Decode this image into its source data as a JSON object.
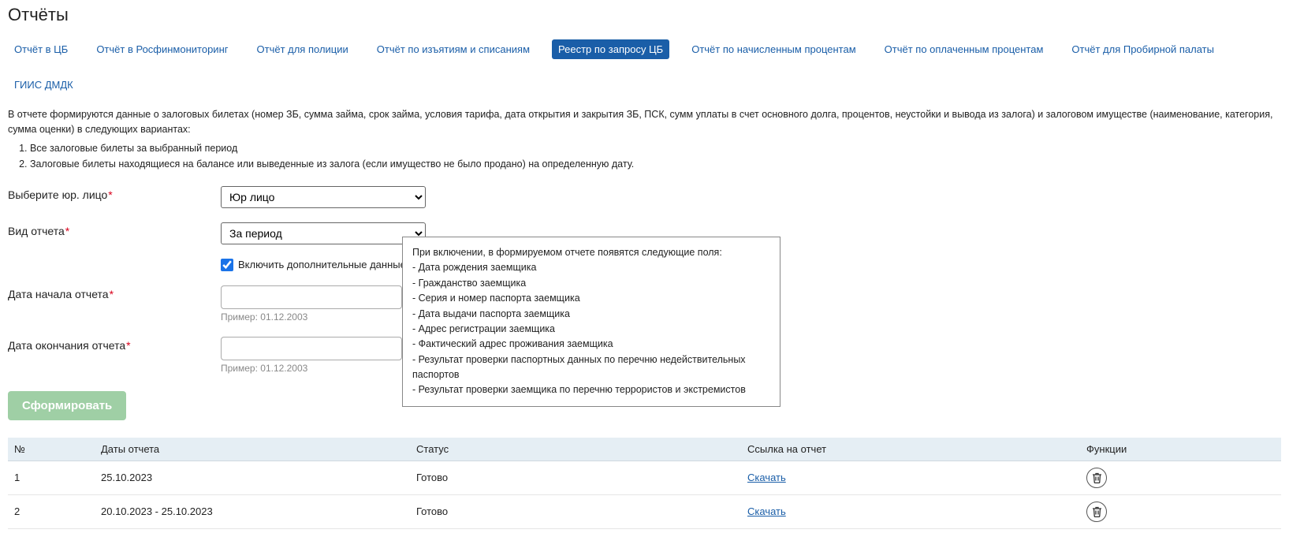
{
  "page_title": "Отчёты",
  "tabs": [
    {
      "label": "Отчёт в ЦБ",
      "active": false
    },
    {
      "label": "Отчёт в Росфинмониторинг",
      "active": false
    },
    {
      "label": "Отчёт для полиции",
      "active": false
    },
    {
      "label": "Отчёт по изъятиям и списаниям",
      "active": false
    },
    {
      "label": "Реестр по запросу ЦБ",
      "active": true
    },
    {
      "label": "Отчёт по начисленным процентам",
      "active": false
    },
    {
      "label": "Отчёт по оплаченным процентам",
      "active": false
    },
    {
      "label": "Отчёт для Пробирной палаты",
      "active": false
    },
    {
      "label": "ГИИС ДМДК",
      "active": false
    }
  ],
  "description": "В отчете формируются данные о залоговых билетах (номер ЗБ, сумма займа, срок займа, условия тарифа, дата открытия и закрытия ЗБ, ПСК, сумм уплаты в счет основного долга, процентов, неустойки и вывода из залога) и залоговом имуществе (наименование, категория, сумма оценки) в следующих вариантах:",
  "variants": [
    "Все залоговые билеты за выбранный период",
    "Залоговые билеты находящиеся на балансе или выведенные из залога (если имущество не было продано) на определенную дату."
  ],
  "form": {
    "entity_label": "Выберите юр. лицо",
    "entity_selected": "Юр лицо",
    "type_label": "Вид отчета",
    "type_selected": "За период",
    "include_extra_label": "Включить дополнительные данные",
    "include_extra_checked": true,
    "date_from_label": "Дата начала отчета",
    "date_from_value": "",
    "date_from_hint": "Пример: 01.12.2003",
    "date_to_label": "Дата окончания отчета",
    "date_to_value": "",
    "date_to_hint": "Пример: 01.12.2003",
    "submit_label": "Сформировать"
  },
  "tooltip": {
    "intro": "При включении, в формируемом отчете появятся следующие поля:",
    "items": [
      "Дата рождения заемщика",
      "Гражданство заемщика",
      "Серия и номер паспорта заемщика",
      "Дата выдачи паспорта заемщика",
      "Адрес регистрации заемщика",
      "Фактический адрес проживания заемщика",
      "Результат проверки паспортных данных по перечню недействительных паспортов",
      "Результат проверки заемщика по перечню террористов и экстремистов"
    ]
  },
  "table": {
    "headers": {
      "num": "№",
      "dates": "Даты отчета",
      "status": "Статус",
      "link": "Ссылка на отчет",
      "func": "Функции"
    },
    "download_label": "Скачать",
    "rows": [
      {
        "num": "1",
        "dates": "25.10.2023",
        "status": "Готово"
      },
      {
        "num": "2",
        "dates": "20.10.2023 - 25.10.2023",
        "status": "Готово"
      }
    ]
  }
}
